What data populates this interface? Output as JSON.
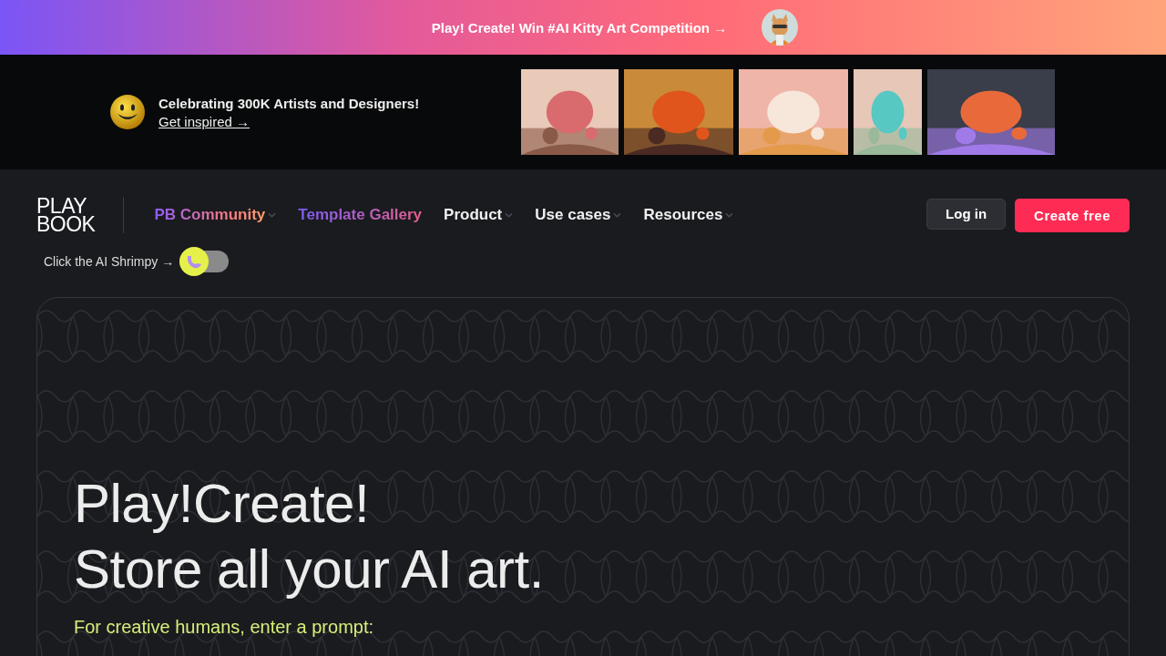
{
  "announcement": {
    "text": "Play! Create! Win #AI Kitty Art Competition →"
  },
  "promo": {
    "title": "Celebrating 300K Artists and Designers!",
    "link": "Get inspired →"
  },
  "nav": {
    "logo": [
      "PLAY",
      "BOOK"
    ],
    "items": [
      {
        "label": "PB Community",
        "kind": "gradient-warm",
        "dropdown": true
      },
      {
        "label": "Template Gallery",
        "kind": "gradient-cool",
        "dropdown": false
      },
      {
        "label": "Product",
        "kind": "plain",
        "dropdown": true
      },
      {
        "label": "Use cases",
        "kind": "plain",
        "dropdown": true
      },
      {
        "label": "Resources",
        "kind": "plain",
        "dropdown": true
      }
    ],
    "login": "Log in",
    "signup": "Create free"
  },
  "shrimp_toggle": {
    "label": "Click the AI Shrimpy →",
    "on": false
  },
  "hero": {
    "headline": [
      "Play!Create!",
      "Store all your AI art."
    ],
    "prompt_label": "For creative humans, enter a prompt:"
  }
}
